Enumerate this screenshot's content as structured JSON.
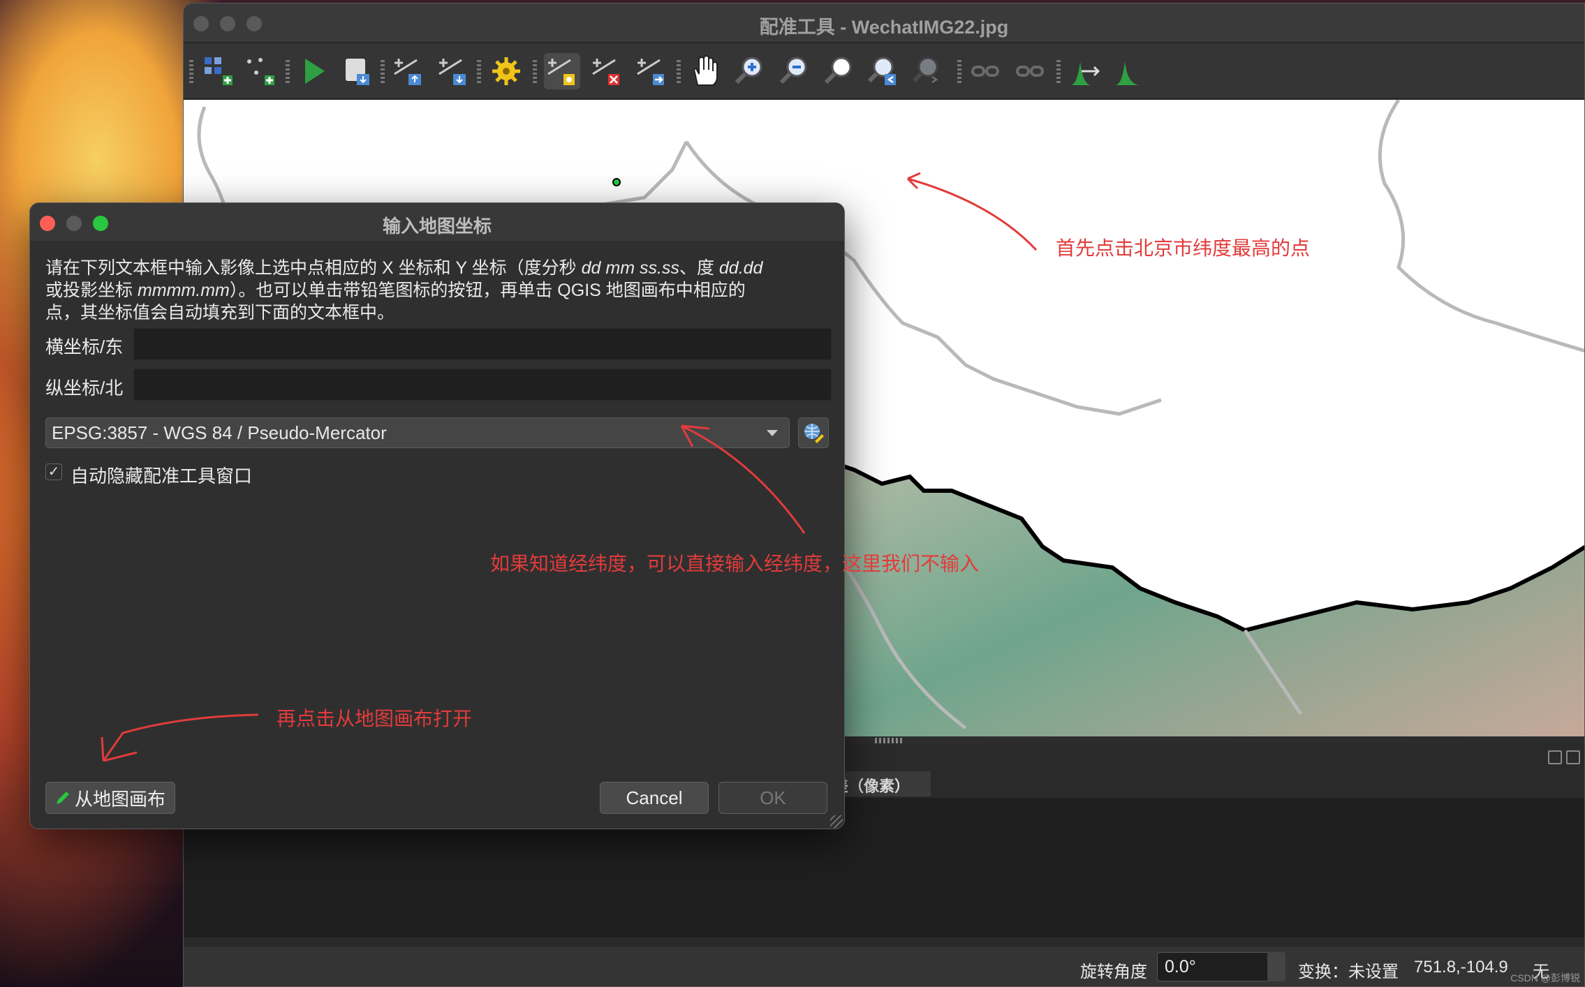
{
  "main_window": {
    "title": "配准工具 - WechatIMG22.jpg"
  },
  "toolbar": {
    "icons": [
      "add-raster-icon",
      "add-point-icon",
      "start-georeferencing-icon",
      "generate-gdal-script-icon",
      "load-gcp-icon",
      "save-gcp-icon",
      "transformation-settings-icon",
      "add-point-tool-icon",
      "delete-point-icon",
      "move-gcp-icon",
      "pan-icon",
      "zoom-in-icon",
      "zoom-out-icon",
      "zoom-layer-icon",
      "zoom-last-icon",
      "zoom-next-icon",
      "link-georef-icon",
      "link-qgis-icon",
      "full-histogram-stretch-icon",
      "local-histogram-stretch-icon"
    ]
  },
  "dialog": {
    "title": "输入地图坐标",
    "instruction_line1_prefix": "请在下列文本框中输入影像上选中点相应的 X 坐标和 Y 坐标（度分秒 ",
    "instruction_line1_dms": "dd mm ss.ss",
    "instruction_line1_mid": "、度 ",
    "instruction_line1_dd": "dd.dd",
    "instruction_line2_prefix": "或投影坐标 ",
    "instruction_line2_proj": "mmmm.mm",
    "instruction_line2_suffix": "）。也可以单击带铅笔图标的按钮，再单击 QGIS 地图画布中相应的",
    "instruction_line3": "点，其坐标值会自动填充到下面的文本框中。",
    "x_label": "横坐标/东",
    "x_value": "",
    "y_label": "纵坐标/北",
    "y_value": "",
    "crs_selected": "EPSG:3857 - WGS 84 / Pseudo-Mercator",
    "autohide_checked": true,
    "autohide_label": "自动隐藏配准工具窗口",
    "from_canvas_label": "从地图画布",
    "cancel_label": "Cancel",
    "ok_label": "OK"
  },
  "dock": {
    "column_label": "差（像素）"
  },
  "statusbar": {
    "rotation_label": "旋转角度",
    "rotation_value": "0.0°",
    "transform_text": "变换：未设置",
    "coordinates": "751.8,-104.9",
    "units": "无"
  },
  "watermark": "CSDN @彭博锐",
  "annotations": {
    "click_highest": "首先点击北京市纬度最高的点",
    "input_lonlat": "如果知道经纬度，可以直接输入经纬度，这里我们不输入",
    "click_canvas": "再点击从地图画布打开"
  },
  "colors": {
    "annotation": "#e23b3b",
    "gcp_point": "#27c93f"
  }
}
